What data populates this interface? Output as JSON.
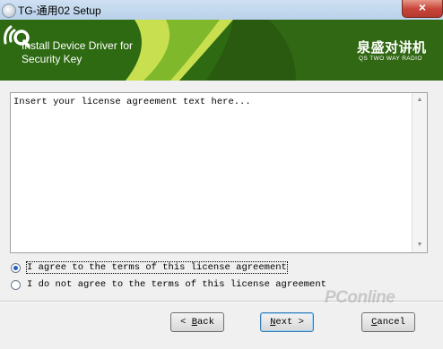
{
  "window": {
    "title": "TG-通用02 Setup",
    "close_glyph": "×"
  },
  "banner": {
    "line1": "Install Device Driver for",
    "line2": "Security Key",
    "logo_cn": "泉盛对讲机",
    "logo_en": "QS TWO WAY RADIO"
  },
  "license": {
    "text": "Insert your license agreement text here..."
  },
  "options": {
    "agree": "I agree to the terms of this license agreement",
    "disagree": "I do not agree to the terms of this license agreement",
    "selected": "agree"
  },
  "buttons": {
    "back_underlined": "B",
    "back_rest": "ack",
    "back_prefix": "< ",
    "next_underlined": "N",
    "next_rest": "ext >",
    "cancel_underlined": "C",
    "cancel_rest": "ancel"
  },
  "watermark": {
    "text": "PConline"
  },
  "colors": {
    "banner_green": "#2e6a12",
    "radio_selected": "#1f5fc0",
    "close_red": "#c8453a"
  },
  "icons": [
    "app-icon",
    "close-icon",
    "qs-logo-icon",
    "scroll-up-icon",
    "scroll-down-icon"
  ]
}
